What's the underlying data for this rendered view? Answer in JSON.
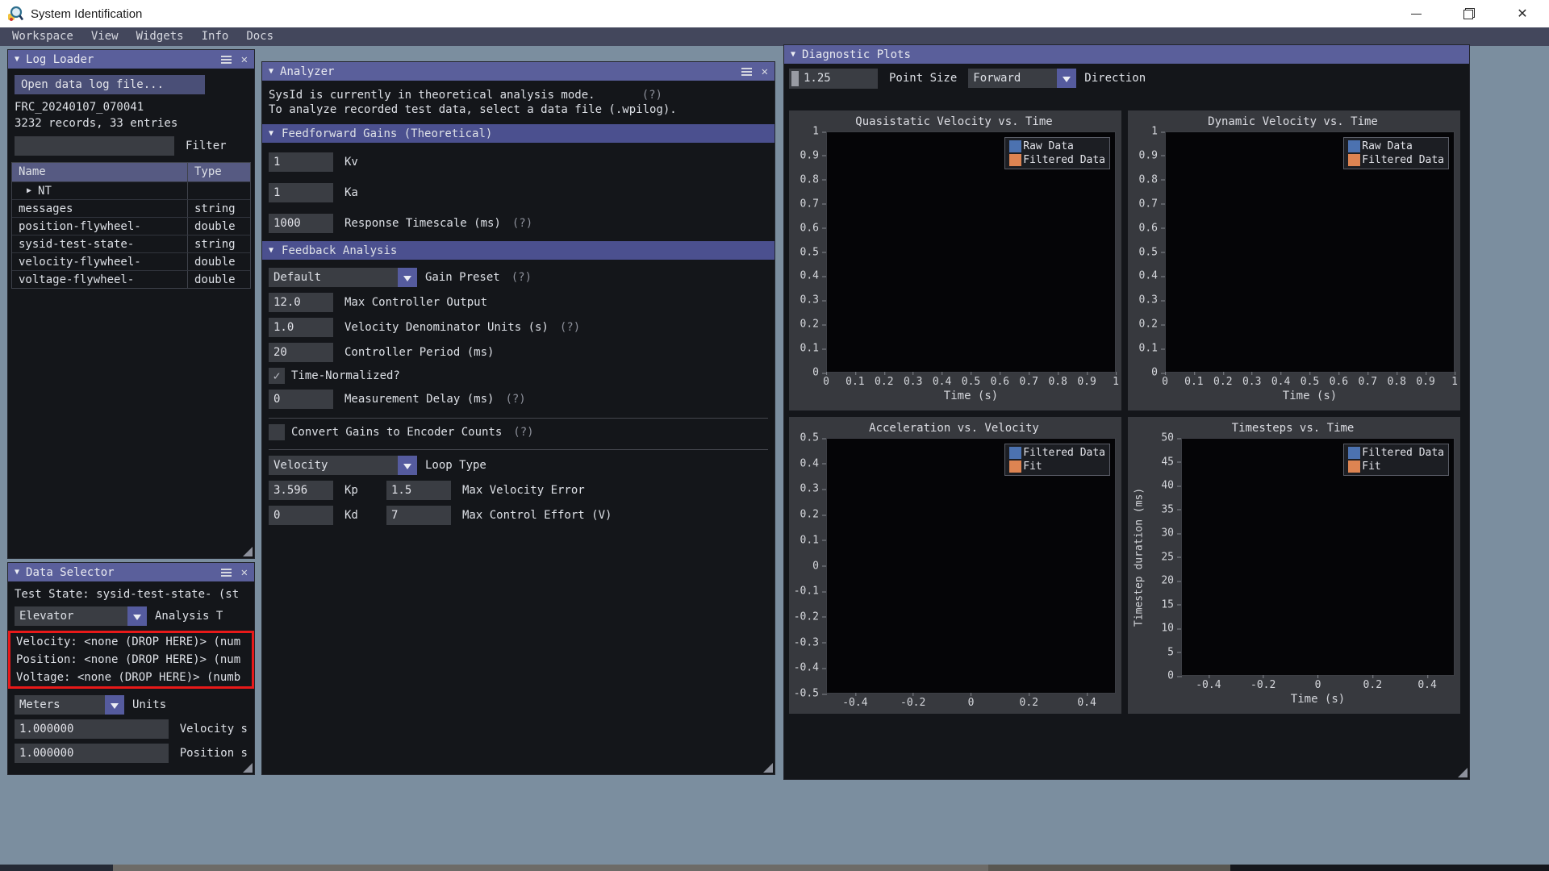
{
  "window": {
    "title": "System Identification"
  },
  "glyphs": {
    "collapse": "▼",
    "expand": "▶",
    "close": "✕",
    "check": "✓",
    "help": "(?)"
  },
  "menu": {
    "items": [
      {
        "label": "Workspace"
      },
      {
        "label": "View"
      },
      {
        "label": "Widgets"
      },
      {
        "label": "Info"
      },
      {
        "label": "Docs"
      }
    ]
  },
  "log_loader": {
    "title": "Log Loader",
    "open_button_label": "Open data log file...",
    "file_name": "FRC_20240107_070041",
    "records_summary": "3232 records, 33 entries",
    "filter_value": "",
    "filter_label": "Filter",
    "columns": [
      "Name",
      "Type"
    ],
    "rows": [
      {
        "name": "NT",
        "type": "",
        "expandable": true
      },
      {
        "name": "messages",
        "type": "string"
      },
      {
        "name": "position-flywheel-",
        "type": "double"
      },
      {
        "name": "sysid-test-state-",
        "type": "string"
      },
      {
        "name": "velocity-flywheel-",
        "type": "double"
      },
      {
        "name": "voltage-flywheel-",
        "type": "double"
      }
    ]
  },
  "data_selector": {
    "title": "Data Selector",
    "test_state_line": "Test State: sysid-test-state- (st",
    "analysis_type_value": "Elevator",
    "analysis_type_label": "Analysis T",
    "drop_lines": [
      "Velocity: <none (DROP HERE)> (num",
      "Position: <none (DROP HERE)> (num",
      "Voltage: <none (DROP HERE)> (numb"
    ],
    "units_value": "Meters",
    "units_label": "Units",
    "velocity_scale_value": "1.000000",
    "velocity_scale_label": "Velocity s",
    "position_scale_value": "1.000000",
    "position_scale_label": "Position s"
  },
  "analyzer": {
    "title": "Analyzer",
    "mode_line1": "SysId is currently in theoretical analysis mode.",
    "mode_line2": "To analyze recorded test data, select a data file (.wpilog).",
    "ff_header": "Feedforward Gains (Theoretical)",
    "kv_value": "1",
    "kv_label": "Kv",
    "ka_value": "1",
    "ka_label": "Ka",
    "timescale_value": "1000",
    "timescale_label": "Response Timescale (ms)",
    "fb_header": "Feedback Analysis",
    "gain_preset_value": "Default",
    "gain_preset_label": "Gain Preset",
    "max_output_value": "12.0",
    "max_output_label": "Max Controller Output",
    "vel_denom_value": "1.0",
    "vel_denom_label": "Velocity Denominator Units (s)",
    "period_value": "20",
    "period_label": "Controller Period (ms)",
    "time_normalized_label": "Time-Normalized?",
    "time_normalized_checked": true,
    "meas_delay_value": "0",
    "meas_delay_label": "Measurement Delay (ms)",
    "convert_label": "Convert Gains to Encoder Counts",
    "convert_checked": false,
    "loop_type_value": "Velocity",
    "loop_type_label": "Loop Type",
    "kp_value": "3.596",
    "kp_label": "Kp",
    "kd_value": "0",
    "kd_label": "Kd",
    "max_vel_err_value": "1.5",
    "max_vel_err_label": "Max Velocity Error",
    "max_effort_value": "7",
    "max_effort_label": "Max Control Effort (V)"
  },
  "diagnostic_plots": {
    "title": "Diagnostic Plots",
    "point_size_value": "1.25",
    "point_size_label": "Point Size",
    "direction_value": "Forward",
    "direction_label": "Direction"
  },
  "chart_data": [
    {
      "type": "scatter",
      "title": "Quasistatic Velocity vs. Time",
      "xlabel": "Time (s)",
      "ylabel": "",
      "xlim": [
        0,
        1
      ],
      "ylim": [
        0,
        1
      ],
      "grid": false,
      "legend_position": "top-right",
      "xticks": [
        {
          "label": "0",
          "pos": 0
        },
        {
          "label": "0.1",
          "pos": 0.1
        },
        {
          "label": "0.2",
          "pos": 0.2
        },
        {
          "label": "0.3",
          "pos": 0.3
        },
        {
          "label": "0.4",
          "pos": 0.4
        },
        {
          "label": "0.5",
          "pos": 0.5
        },
        {
          "label": "0.6",
          "pos": 0.6
        },
        {
          "label": "0.7",
          "pos": 0.7
        },
        {
          "label": "0.8",
          "pos": 0.8
        },
        {
          "label": "0.9",
          "pos": 0.9
        },
        {
          "label": "1",
          "pos": 1
        }
      ],
      "yticks": [
        {
          "label": "1",
          "pos": 0
        },
        {
          "label": "0.9",
          "pos": 0.1
        },
        {
          "label": "0.8",
          "pos": 0.2
        },
        {
          "label": "0.7",
          "pos": 0.3
        },
        {
          "label": "0.6",
          "pos": 0.4
        },
        {
          "label": "0.5",
          "pos": 0.5
        },
        {
          "label": "0.4",
          "pos": 0.6
        },
        {
          "label": "0.3",
          "pos": 0.7
        },
        {
          "label": "0.2",
          "pos": 0.8
        },
        {
          "label": "0.1",
          "pos": 0.9
        },
        {
          "label": "0",
          "pos": 1
        }
      ],
      "legend": [
        {
          "label": "Raw Data",
          "color": "#4c72b0"
        },
        {
          "label": "Filtered Data",
          "color": "#dd8452"
        }
      ],
      "series": [
        {
          "name": "Raw Data",
          "color": "#4c72b0",
          "points": []
        },
        {
          "name": "Filtered Data",
          "color": "#dd8452",
          "points": []
        }
      ]
    },
    {
      "type": "scatter",
      "title": "Dynamic Velocity vs. Time",
      "xlabel": "Time (s)",
      "ylabel": "",
      "xlim": [
        0,
        1
      ],
      "ylim": [
        0,
        1
      ],
      "grid": false,
      "legend_position": "top-right",
      "xticks": [
        {
          "label": "0",
          "pos": 0
        },
        {
          "label": "0.1",
          "pos": 0.1
        },
        {
          "label": "0.2",
          "pos": 0.2
        },
        {
          "label": "0.3",
          "pos": 0.3
        },
        {
          "label": "0.4",
          "pos": 0.4
        },
        {
          "label": "0.5",
          "pos": 0.5
        },
        {
          "label": "0.6",
          "pos": 0.6
        },
        {
          "label": "0.7",
          "pos": 0.7
        },
        {
          "label": "0.8",
          "pos": 0.8
        },
        {
          "label": "0.9",
          "pos": 0.9
        },
        {
          "label": "1",
          "pos": 1
        }
      ],
      "yticks": [
        {
          "label": "1",
          "pos": 0
        },
        {
          "label": "0.9",
          "pos": 0.1
        },
        {
          "label": "0.8",
          "pos": 0.2
        },
        {
          "label": "0.7",
          "pos": 0.3
        },
        {
          "label": "0.6",
          "pos": 0.4
        },
        {
          "label": "0.5",
          "pos": 0.5
        },
        {
          "label": "0.4",
          "pos": 0.6
        },
        {
          "label": "0.3",
          "pos": 0.7
        },
        {
          "label": "0.2",
          "pos": 0.8
        },
        {
          "label": "0.1",
          "pos": 0.9
        },
        {
          "label": "0",
          "pos": 1
        }
      ],
      "legend": [
        {
          "label": "Raw Data",
          "color": "#4c72b0"
        },
        {
          "label": "Filtered Data",
          "color": "#dd8452"
        }
      ],
      "series": [
        {
          "name": "Raw Data",
          "color": "#4c72b0",
          "points": []
        },
        {
          "name": "Filtered Data",
          "color": "#dd8452",
          "points": []
        }
      ]
    },
    {
      "type": "scatter",
      "title": "Acceleration vs. Velocity",
      "xlabel": "",
      "ylabel": "",
      "xlim": [
        -0.5,
        0.5
      ],
      "ylim": [
        -0.5,
        0.5
      ],
      "grid": false,
      "legend_position": "top-right",
      "xticks": [
        {
          "label": "-0.4",
          "pos": 0.1
        },
        {
          "label": "-0.2",
          "pos": 0.3
        },
        {
          "label": "0",
          "pos": 0.5
        },
        {
          "label": "0.2",
          "pos": 0.7
        },
        {
          "label": "0.4",
          "pos": 0.9
        }
      ],
      "yticks": [
        {
          "label": "0.5",
          "pos": 0
        },
        {
          "label": "0.4",
          "pos": 0.1
        },
        {
          "label": "0.3",
          "pos": 0.2
        },
        {
          "label": "0.2",
          "pos": 0.3
        },
        {
          "label": "0.1",
          "pos": 0.4
        },
        {
          "label": "0",
          "pos": 0.5
        },
        {
          "label": "-0.1",
          "pos": 0.6
        },
        {
          "label": "-0.2",
          "pos": 0.7
        },
        {
          "label": "-0.3",
          "pos": 0.8
        },
        {
          "label": "-0.4",
          "pos": 0.9
        },
        {
          "label": "-0.5",
          "pos": 1
        }
      ],
      "legend": [
        {
          "label": "Filtered Data",
          "color": "#4c72b0"
        },
        {
          "label": "Fit",
          "color": "#dd8452"
        }
      ],
      "series": [
        {
          "name": "Filtered Data",
          "color": "#4c72b0",
          "points": []
        },
        {
          "name": "Fit",
          "color": "#dd8452",
          "points": []
        }
      ]
    },
    {
      "type": "scatter",
      "title": "Timesteps vs. Time",
      "xlabel": "Time (s)",
      "ylabel": "Timestep duration (ms)",
      "xlim": [
        -0.5,
        0.5
      ],
      "ylim": [
        0,
        50
      ],
      "grid": false,
      "legend_position": "top-right",
      "xticks": [
        {
          "label": "-0.4",
          "pos": 0.1
        },
        {
          "label": "-0.2",
          "pos": 0.3
        },
        {
          "label": "0",
          "pos": 0.5
        },
        {
          "label": "0.2",
          "pos": 0.7
        },
        {
          "label": "0.4",
          "pos": 0.9
        }
      ],
      "yticks": [
        {
          "label": "50",
          "pos": 0
        },
        {
          "label": "45",
          "pos": 0.1
        },
        {
          "label": "40",
          "pos": 0.2
        },
        {
          "label": "35",
          "pos": 0.3
        },
        {
          "label": "30",
          "pos": 0.4
        },
        {
          "label": "25",
          "pos": 0.5
        },
        {
          "label": "20",
          "pos": 0.6
        },
        {
          "label": "15",
          "pos": 0.7
        },
        {
          "label": "10",
          "pos": 0.8
        },
        {
          "label": "5",
          "pos": 0.9
        },
        {
          "label": "0",
          "pos": 1
        }
      ],
      "legend": [
        {
          "label": "Filtered Data",
          "color": "#4c72b0"
        },
        {
          "label": "Fit",
          "color": "#dd8452"
        }
      ],
      "series": [
        {
          "name": "Filtered Data",
          "color": "#4c72b0",
          "points": []
        },
        {
          "name": "Fit",
          "color": "#dd8452",
          "points": []
        }
      ]
    }
  ],
  "colors": {
    "panel_header": "#5a5f9b",
    "section_header": "#4b508f",
    "panel_bg": "#14161a",
    "input_bg": "#3a3d43",
    "desktop_bg": "#7b8e9f",
    "menu_bg": "#43475c",
    "series_blue": "#4c72b0",
    "series_orange": "#dd8452",
    "drop_highlight": "#e81919"
  }
}
